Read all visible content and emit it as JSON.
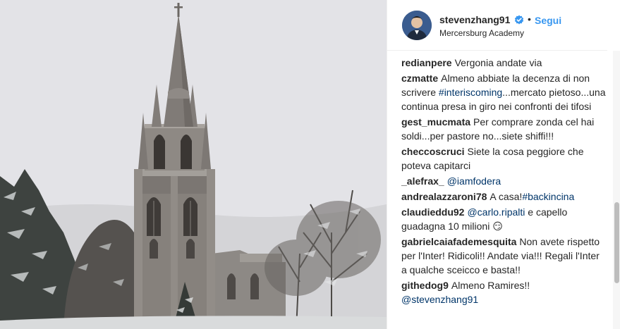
{
  "post": {
    "username": "stevenzhang91",
    "separator": "•",
    "follow_label": "Segui",
    "location": "Mercersburg Academy"
  },
  "comments": [
    {
      "user": "redianpere",
      "parts": [
        {
          "t": "text",
          "v": "Vergonia andate via"
        }
      ]
    },
    {
      "user": "czmatte",
      "parts": [
        {
          "t": "text",
          "v": "Almeno abbiate la decenza di non scrivere "
        },
        {
          "t": "link",
          "v": "#interiscoming"
        },
        {
          "t": "text",
          "v": "...mercato pietoso...una continua presa in giro nei confronti dei tifosi"
        }
      ]
    },
    {
      "user": "gest_mucmata",
      "parts": [
        {
          "t": "text",
          "v": "Per comprare zonda cel hai soldi...per pastore no...siete shiffi!!!"
        }
      ]
    },
    {
      "user": "checcoscruci",
      "parts": [
        {
          "t": "text",
          "v": "Siete la cosa peggiore che poteva capitarci"
        }
      ]
    },
    {
      "user": "_alefrax_",
      "parts": [
        {
          "t": "link",
          "v": "@iamfodera"
        }
      ]
    },
    {
      "user": "andrealazzaroni78",
      "parts": [
        {
          "t": "text",
          "v": "A casa!"
        },
        {
          "t": "link",
          "v": "#backincina"
        }
      ]
    },
    {
      "user": "claudieddu92",
      "parts": [
        {
          "t": "link",
          "v": "@carlo.ripalti"
        },
        {
          "t": "text",
          "v": " e capello guadagna 10 milioni 😏"
        }
      ]
    },
    {
      "user": "gabrielcaiafademesquita",
      "parts": [
        {
          "t": "text",
          "v": "Non avete rispetto per l'Inter! Ridicoli!! Andate via!!! Regali l'Inter a qualche sceicco e basta!!"
        }
      ]
    },
    {
      "user": "githedog9",
      "parts": [
        {
          "t": "text",
          "v": "Almeno Ramires!! "
        },
        {
          "t": "link",
          "v": "@stevenzhang91"
        }
      ]
    }
  ],
  "icons": {
    "avatar": "profile-avatar",
    "verified": "verified-badge-icon"
  },
  "colors": {
    "link": "#003569",
    "follow": "#3897f0",
    "verified": "#3897f0",
    "text": "#262626"
  }
}
